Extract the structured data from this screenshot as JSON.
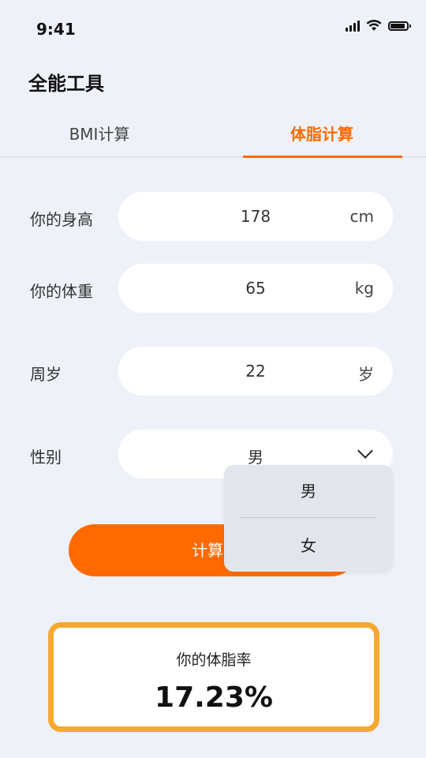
{
  "status_bar": {
    "time": "9:41",
    "icons": [
      "signal-icon",
      "wifi-icon",
      "battery-icon"
    ]
  },
  "header": {
    "title": "全能工具"
  },
  "tabs": [
    {
      "label": "BMI计算",
      "active": false
    },
    {
      "label": "体脂计算",
      "active": true
    }
  ],
  "form": {
    "height": {
      "label": "你的身高",
      "value": "178",
      "unit": "cm"
    },
    "weight": {
      "label": "你的体重",
      "value": "65",
      "unit": "kg"
    },
    "age": {
      "label": "周岁",
      "value": "22",
      "unit": "岁"
    },
    "gender": {
      "label": "性别",
      "value": "男",
      "icon": "chevron-down-icon"
    }
  },
  "gender_dropdown": {
    "options": [
      "男",
      "女"
    ]
  },
  "calculate_button": {
    "label": "计算B"
  },
  "result": {
    "label": "你的体脂率",
    "value": "17.23%"
  },
  "colors": {
    "accent": "#ff6a00",
    "result_border": "#f7a830",
    "background": "#eef1f8",
    "dropdown_bg": "#e2e6ec"
  }
}
